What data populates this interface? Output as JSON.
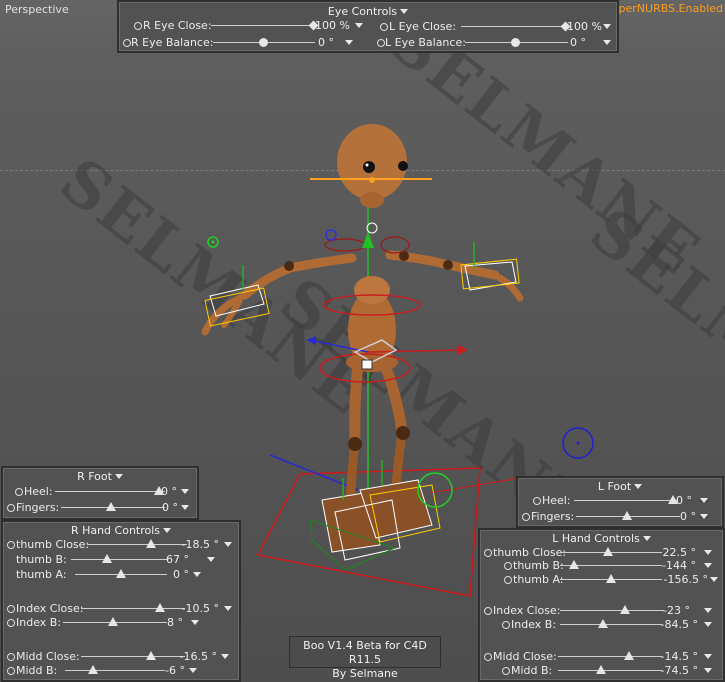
{
  "viewport": {
    "label": "Perspective",
    "status": "HyperNURBS.Enabled",
    "watermark": "SELMANE"
  },
  "eye_panel": {
    "title": "Eye Controls",
    "r_eye_close": {
      "label": "R Eye Close:",
      "value": "100 %"
    },
    "l_eye_close": {
      "label": "L Eye Close:",
      "value": "100 %"
    },
    "r_eye_balance": {
      "label": "R Eye Balance:",
      "value": "0 °"
    },
    "l_eye_balance": {
      "label": "L Eye Balance:",
      "value": "0 °"
    }
  },
  "r_foot": {
    "title": "R Foot",
    "heel": {
      "label": "Heel:",
      "value": "0 °"
    },
    "fingers": {
      "label": "Fingers:",
      "value": "0 °"
    }
  },
  "l_foot": {
    "title": "L Foot",
    "heel": {
      "label": "Heel:",
      "value": "0 °"
    },
    "fingers": {
      "label": "Fingers:",
      "value": "0 °"
    }
  },
  "r_hand": {
    "title": "R Hand Controls",
    "thumb_close": {
      "label": "thumb Close:",
      "value": "-18.5 °"
    },
    "thumb_b": {
      "label": "thumb B:",
      "value": "67 °"
    },
    "thumb_a": {
      "label": "thumb A:",
      "value": "0 °"
    },
    "index_close": {
      "label": "Index Close:",
      "value": "-10.5 °"
    },
    "index_b": {
      "label": "Index B:",
      "value": "8 °"
    },
    "midd_close": {
      "label": "Midd Close:",
      "value": "-16.5 °"
    },
    "midd_b": {
      "label": "Midd  B:",
      "value": "-6 °"
    }
  },
  "l_hand": {
    "title": "L Hand Controls",
    "thumb_close": {
      "label": "thumb Close:",
      "value": "22.5 °"
    },
    "thumb_b": {
      "label": "thumb B:",
      "value": "-144 °"
    },
    "thumb_a": {
      "label": "thumb A:",
      "value": "-156.5 °"
    },
    "index_close": {
      "label": "Index Close:",
      "value": "-23 °"
    },
    "index_b": {
      "label": "Index B:",
      "value": "-84.5 °"
    },
    "midd_close": {
      "label": "Midd Close:",
      "value": "-14.5 °"
    },
    "midd_b": {
      "label": "Midd  B:",
      "value": "-74.5 °"
    }
  },
  "credit": {
    "line1": "Boo V1.4 Beta  for C4D R11.5",
    "line2": "By  Selmane"
  },
  "colors": {
    "panel_bg": "#525252",
    "accent_orange": "#ff9d1a",
    "skin": "#b5713a",
    "selection_white": "#ffffff",
    "axis_red": "#c81e1e",
    "axis_green": "#22c022",
    "axis_blue": "#2828c8"
  }
}
